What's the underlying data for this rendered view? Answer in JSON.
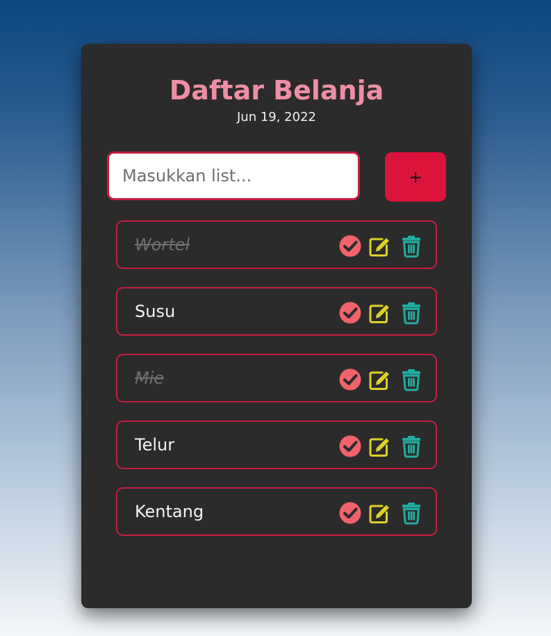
{
  "header": {
    "title": "Daftar Belanja",
    "date": "Jun 19, 2022"
  },
  "input": {
    "placeholder": "Masukkan list...",
    "value": ""
  },
  "add_button": {
    "label": "+"
  },
  "items": [
    {
      "label": "Wortel",
      "done": true
    },
    {
      "label": "Susu",
      "done": false
    },
    {
      "label": "Mie",
      "done": true
    },
    {
      "label": "Telur",
      "done": false
    },
    {
      "label": "Kentang",
      "done": false
    }
  ],
  "icons": {
    "check": "check-circle-icon",
    "edit": "edit-icon",
    "delete": "trash-icon"
  },
  "colors": {
    "title": "#ee8ea4",
    "accent": "#dc143c",
    "border": "#c81e43",
    "check": "#f0636b",
    "edit": "#e0d127",
    "delete": "#20aba0"
  }
}
